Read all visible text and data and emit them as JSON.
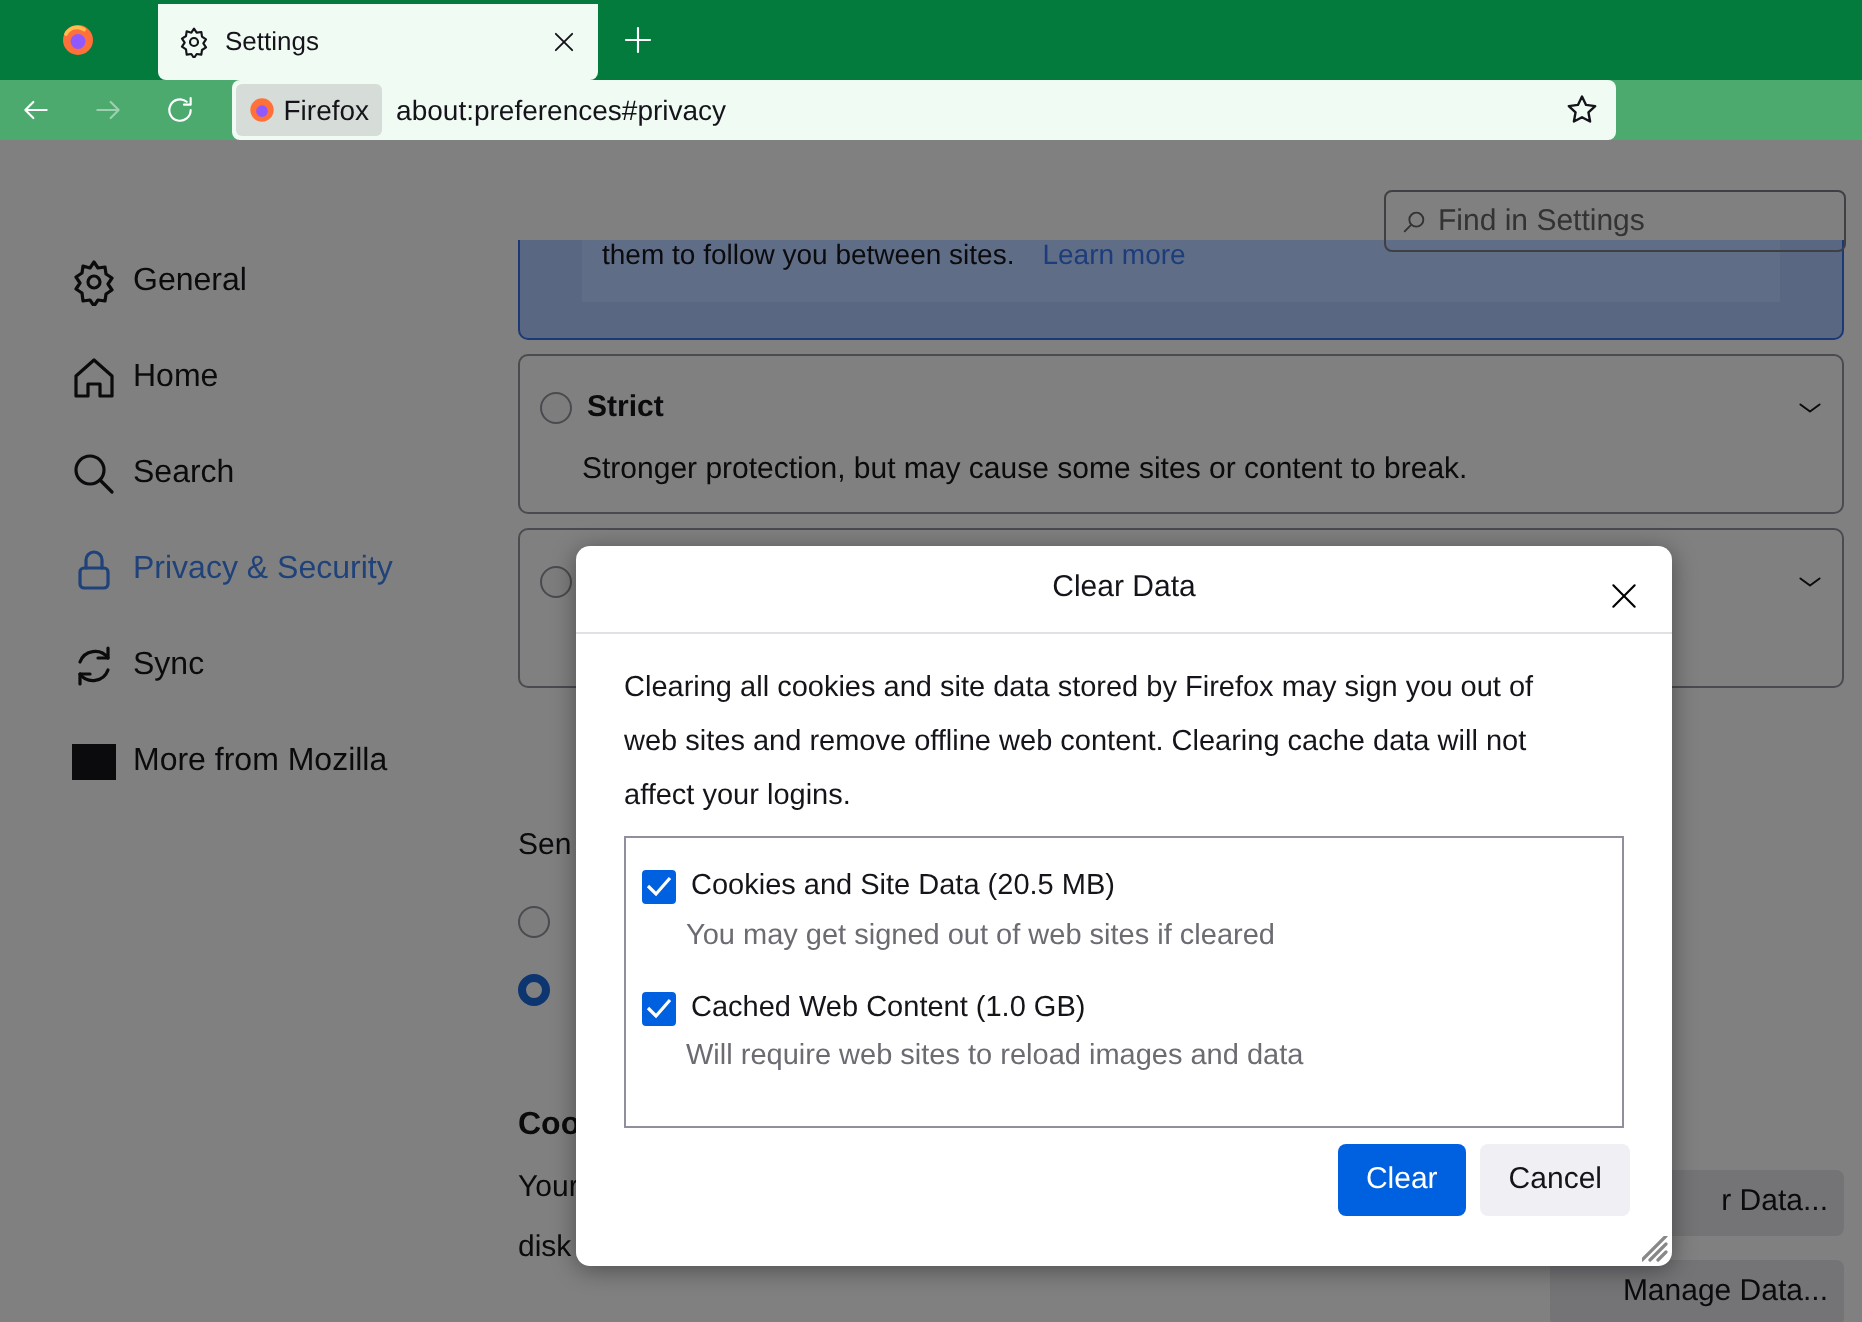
{
  "browser": {
    "tabs": [
      {
        "label": "Settings",
        "selected": true
      }
    ],
    "nav": {
      "forward_disabled": true
    },
    "url_bar": {
      "identity": "Firefox",
      "url": "about:preferences#privacy"
    }
  },
  "page": {
    "search": {
      "placeholder": "Find in Settings"
    },
    "sidebar": {
      "items": [
        {
          "label": "General",
          "selected": false
        },
        {
          "label": "Home",
          "selected": false
        },
        {
          "label": "Search",
          "selected": false
        },
        {
          "label": "Privacy & Security",
          "selected": true
        },
        {
          "label": "Sync",
          "selected": false
        },
        {
          "label": "More from Mozilla",
          "selected": false
        }
      ]
    },
    "tracking": {
      "note": "them to follow you between sites.",
      "learn_more": "Learn more",
      "options": [
        {
          "label": "Strict",
          "description": "Stronger protection, but may cause some sites or content to break.",
          "selected": false
        },
        {
          "selected": false
        }
      ]
    },
    "dnt": {
      "label": "Sen",
      "options": [
        {
          "selected": false
        },
        {
          "selected": true
        }
      ]
    },
    "cookies": {
      "heading": "Coo",
      "lines": [
        "Your",
        "disk"
      ],
      "buttons": [
        "r Data...",
        "Manage Data..."
      ]
    }
  },
  "dialog": {
    "title": "Clear Data",
    "message": "Clearing all cookies and site data stored by Firefox may sign you out of web sites and remove offline web content. Clearing cache data will not affect your logins.",
    "items": [
      {
        "label": "Cookies and Site Data (20.5 MB)",
        "description": "You may get signed out of web sites if cleared",
        "checked": true
      },
      {
        "label": "Cached Web Content (1.0 GB)",
        "description": "Will require web sites to reload images and data",
        "checked": true
      }
    ],
    "buttons": [
      {
        "label": "Clear",
        "primary": true
      },
      {
        "label": "Cancel",
        "primary": false
      }
    ]
  }
}
